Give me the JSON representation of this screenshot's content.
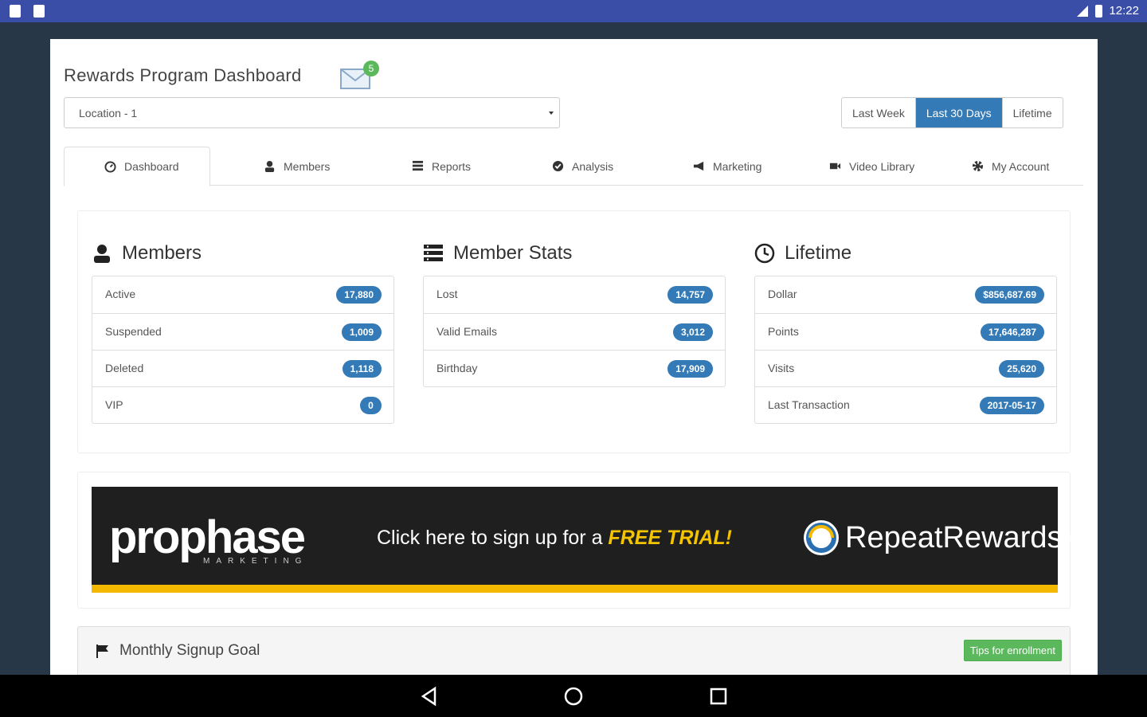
{
  "status_bar": {
    "time": "12:22"
  },
  "header": {
    "title": "Rewards Program Dashboard",
    "mail_badge": "5"
  },
  "location": {
    "selected": "Location - 1"
  },
  "range": {
    "options": [
      "Last Week",
      "Last 30 Days",
      "Lifetime"
    ],
    "active": "Last 30 Days"
  },
  "tabs": [
    {
      "label": "Dashboard",
      "icon": "dashboard-icon"
    },
    {
      "label": "Members",
      "icon": "user-icon"
    },
    {
      "label": "Reports",
      "icon": "list-icon"
    },
    {
      "label": "Analysis",
      "icon": "check-circle-icon"
    },
    {
      "label": "Marketing",
      "icon": "megaphone-icon"
    },
    {
      "label": "Video Library",
      "icon": "video-icon"
    },
    {
      "label": "My Account",
      "icon": "gear-icon"
    }
  ],
  "members": {
    "title": "Members",
    "items": [
      {
        "label": "Active",
        "value": "17,880"
      },
      {
        "label": "Suspended",
        "value": "1,009"
      },
      {
        "label": "Deleted",
        "value": "1,118"
      },
      {
        "label": "VIP",
        "value": "0"
      }
    ]
  },
  "member_stats": {
    "title": "Member Stats",
    "items": [
      {
        "label": "Lost",
        "value": "14,757"
      },
      {
        "label": "Valid Emails",
        "value": "3,012"
      },
      {
        "label": "Birthday",
        "value": "17,909"
      }
    ]
  },
  "lifetime": {
    "title": "Lifetime",
    "items": [
      {
        "label": "Dollar",
        "value": "$856,687.69"
      },
      {
        "label": "Points",
        "value": "17,646,287"
      },
      {
        "label": "Visits",
        "value": "25,620"
      },
      {
        "label": "Last Transaction",
        "value": "2017-05-17"
      }
    ]
  },
  "banner": {
    "logo": "prophase",
    "logo_sub": "MARKETING",
    "cta_prefix": "Click here to sign up for a ",
    "cta_highlight": "FREE TRIAL!",
    "brand": "RepeatRewards",
    "brand_mark": "®",
    "accent": "#f5b800"
  },
  "goal": {
    "title": "Monthly Signup Goal",
    "tip_button": "Tips for enrollment"
  },
  "colors": {
    "primary": "#337ab7",
    "success": "#5cb85c",
    "statusbar": "#3a4ea8"
  }
}
